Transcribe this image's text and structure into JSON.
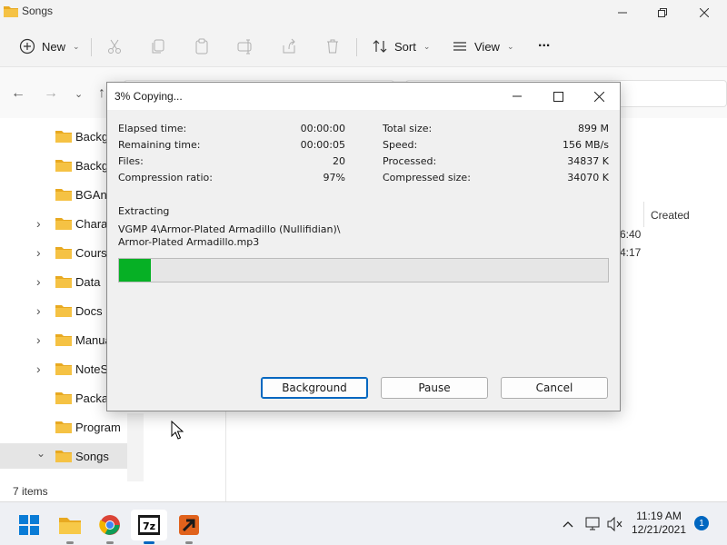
{
  "explorer": {
    "title": "Songs",
    "toolbar": {
      "new_label": "New",
      "sort_label": "Sort",
      "view_label": "View",
      "more_label": "..."
    },
    "sidebar": [
      {
        "label": "Backgr",
        "expander": false
      },
      {
        "label": "Backgr",
        "expander": false
      },
      {
        "label": "BGAnir",
        "expander": false
      },
      {
        "label": "Charac",
        "expander": true
      },
      {
        "label": "Course",
        "expander": true
      },
      {
        "label": "Data",
        "expander": true
      },
      {
        "label": "Docs",
        "expander": true
      },
      {
        "label": "Manua",
        "expander": true
      },
      {
        "label": "NoteSk",
        "expander": true
      },
      {
        "label": "Packag",
        "expander": false
      },
      {
        "label": "Program",
        "expander": false
      },
      {
        "label": "Songs",
        "expander": true,
        "expanded": true,
        "selected": true
      }
    ],
    "column_header": "Created",
    "time_cells": [
      "6:40",
      "4:17"
    ],
    "status": "7 items"
  },
  "dialog": {
    "title": "3% Copying...",
    "left_stats": [
      {
        "label": "Elapsed time:",
        "value": "00:00:00"
      },
      {
        "label": "Remaining time:",
        "value": "00:00:05"
      },
      {
        "label": "Files:",
        "value": "20"
      },
      {
        "label": "Compression ratio:",
        "value": "97%"
      }
    ],
    "right_stats": [
      {
        "label": "Total size:",
        "value": "899 M"
      },
      {
        "label": "Speed:",
        "value": "156 MB/s"
      },
      {
        "label": "Processed:",
        "value": "34837 K"
      },
      {
        "label": "Compressed size:",
        "value": "34070 K"
      }
    ],
    "operation": "Extracting",
    "path_line1": "VGMP 4\\Armor-Plated Armadillo (Nullifidian)\\",
    "path_line2": "Armor-Plated Armadillo.mp3",
    "progress_fraction": 0.065,
    "progress_color": "#06b025",
    "buttons": {
      "background": "Background",
      "pause": "Pause",
      "cancel": "Cancel"
    }
  },
  "taskbar": {
    "apps": [
      "windows-start-icon",
      "file-explorer-icon",
      "chrome-icon",
      "7zip-icon",
      "app-arrow-icon"
    ],
    "time": "11:19 AM",
    "date": "12/21/2021",
    "notification_count": "1"
  },
  "colors": {
    "accent": "#0067c0",
    "folder": "#f5c244"
  }
}
